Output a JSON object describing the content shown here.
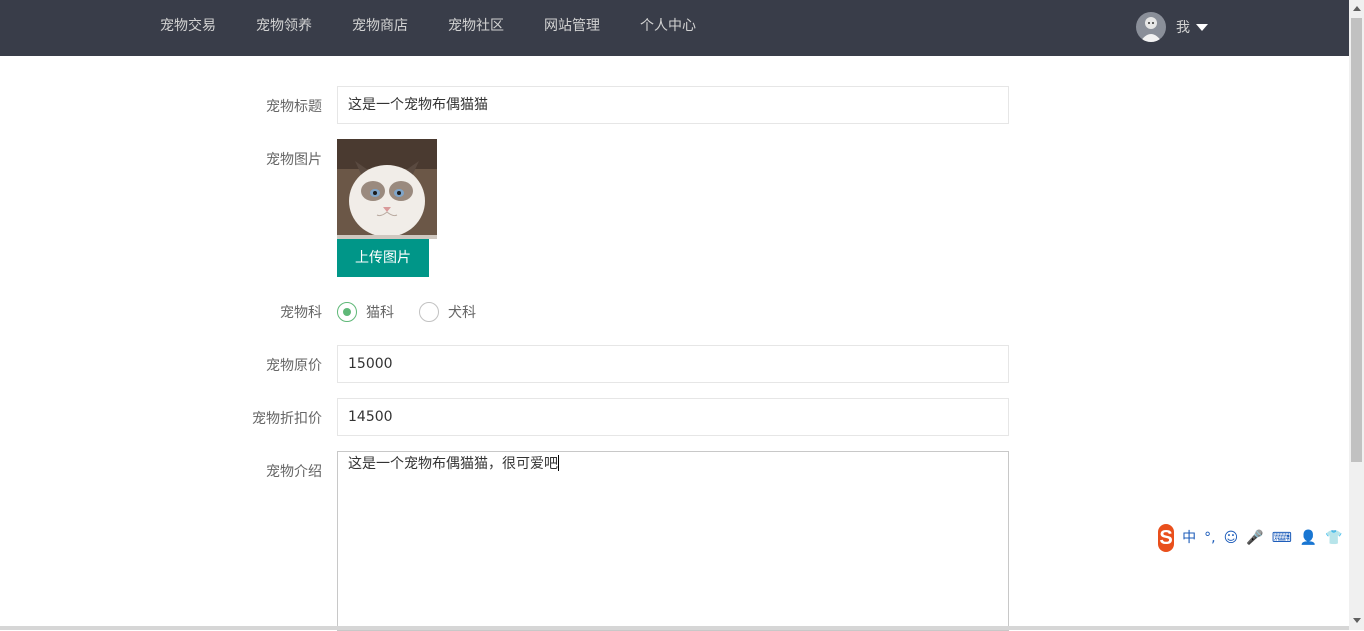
{
  "nav": {
    "items": [
      {
        "label": "宠物交易"
      },
      {
        "label": "宠物领养"
      },
      {
        "label": "宠物商店"
      },
      {
        "label": "宠物社区"
      },
      {
        "label": "网站管理"
      },
      {
        "label": "个人中心"
      }
    ],
    "user_label": "我",
    "user_icon": "avatar",
    "caret_icon": "caret-down-icon"
  },
  "form": {
    "title": {
      "label": "宠物标题",
      "value": "这是一个宠物布偶猫猫"
    },
    "image": {
      "label": "宠物图片",
      "upload_label": "上传图片"
    },
    "family": {
      "label": "宠物科",
      "options": [
        {
          "label": "猫科",
          "checked": true
        },
        {
          "label": "犬科",
          "checked": false
        }
      ]
    },
    "original_price": {
      "label": "宠物原价",
      "value": "15000"
    },
    "discount_price": {
      "label": "宠物折扣价",
      "value": "14500"
    },
    "intro": {
      "label": "宠物介绍",
      "value": "这是一个宠物布偶猫猫，很可爱吧"
    }
  },
  "ime": {
    "logo": "S",
    "items": [
      "中",
      "°,",
      "☺",
      "🎤",
      "⌨",
      "👤",
      "👕",
      "▦"
    ]
  },
  "colors": {
    "navbar": "#393d49",
    "primary_button": "#009688",
    "radio_checked": "#5fb878"
  }
}
